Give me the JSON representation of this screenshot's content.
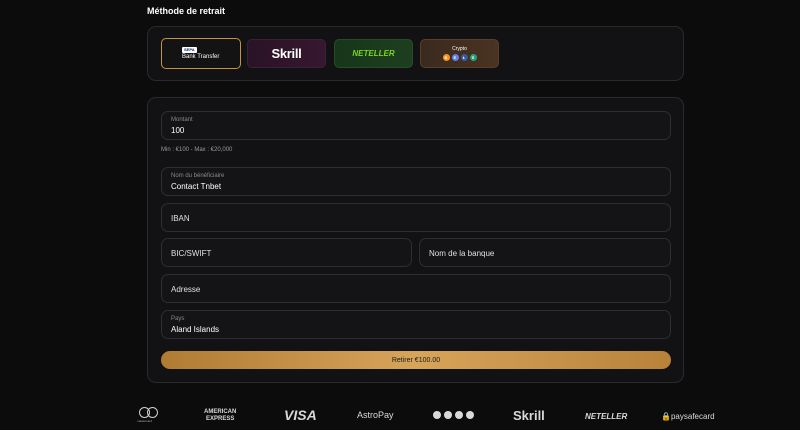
{
  "section_title": "Méthode de retrait",
  "methods": [
    {
      "badge": "SEPA",
      "label": "Bank Transfer"
    },
    {
      "label": "Skrill"
    },
    {
      "label": "NETELLER"
    },
    {
      "label": "Crypto",
      "coins": [
        "B",
        "E",
        "Ł",
        "₮"
      ]
    }
  ],
  "form": {
    "amount": {
      "label": "Montant",
      "value": "100"
    },
    "hint": "Min : €100 - Max : €20,000",
    "beneficiary": {
      "label": "Nom du bénéficiaire",
      "value": "Contact Tnbet"
    },
    "iban": {
      "placeholder": "IBAN"
    },
    "bic": {
      "placeholder": "BIC/SWIFT"
    },
    "bank_name": {
      "placeholder": "Nom de la banque"
    },
    "address": {
      "placeholder": "Adresse"
    },
    "country": {
      "label": "Pays",
      "value": "Aland Islands"
    },
    "submit_label": "Retirer €100.00"
  },
  "footer": {
    "mastercard": "mastercard",
    "amex": "AMERICAN\nEXPRESS",
    "visa": "VISA",
    "astropay": "AstroPay",
    "skrill": "Skrill",
    "neteller": "NETELLER",
    "paysafecard": "paysafecard"
  },
  "colors": {
    "accent": "#c8923e",
    "button": "#d7a45a",
    "background": "#0c0c0d"
  }
}
